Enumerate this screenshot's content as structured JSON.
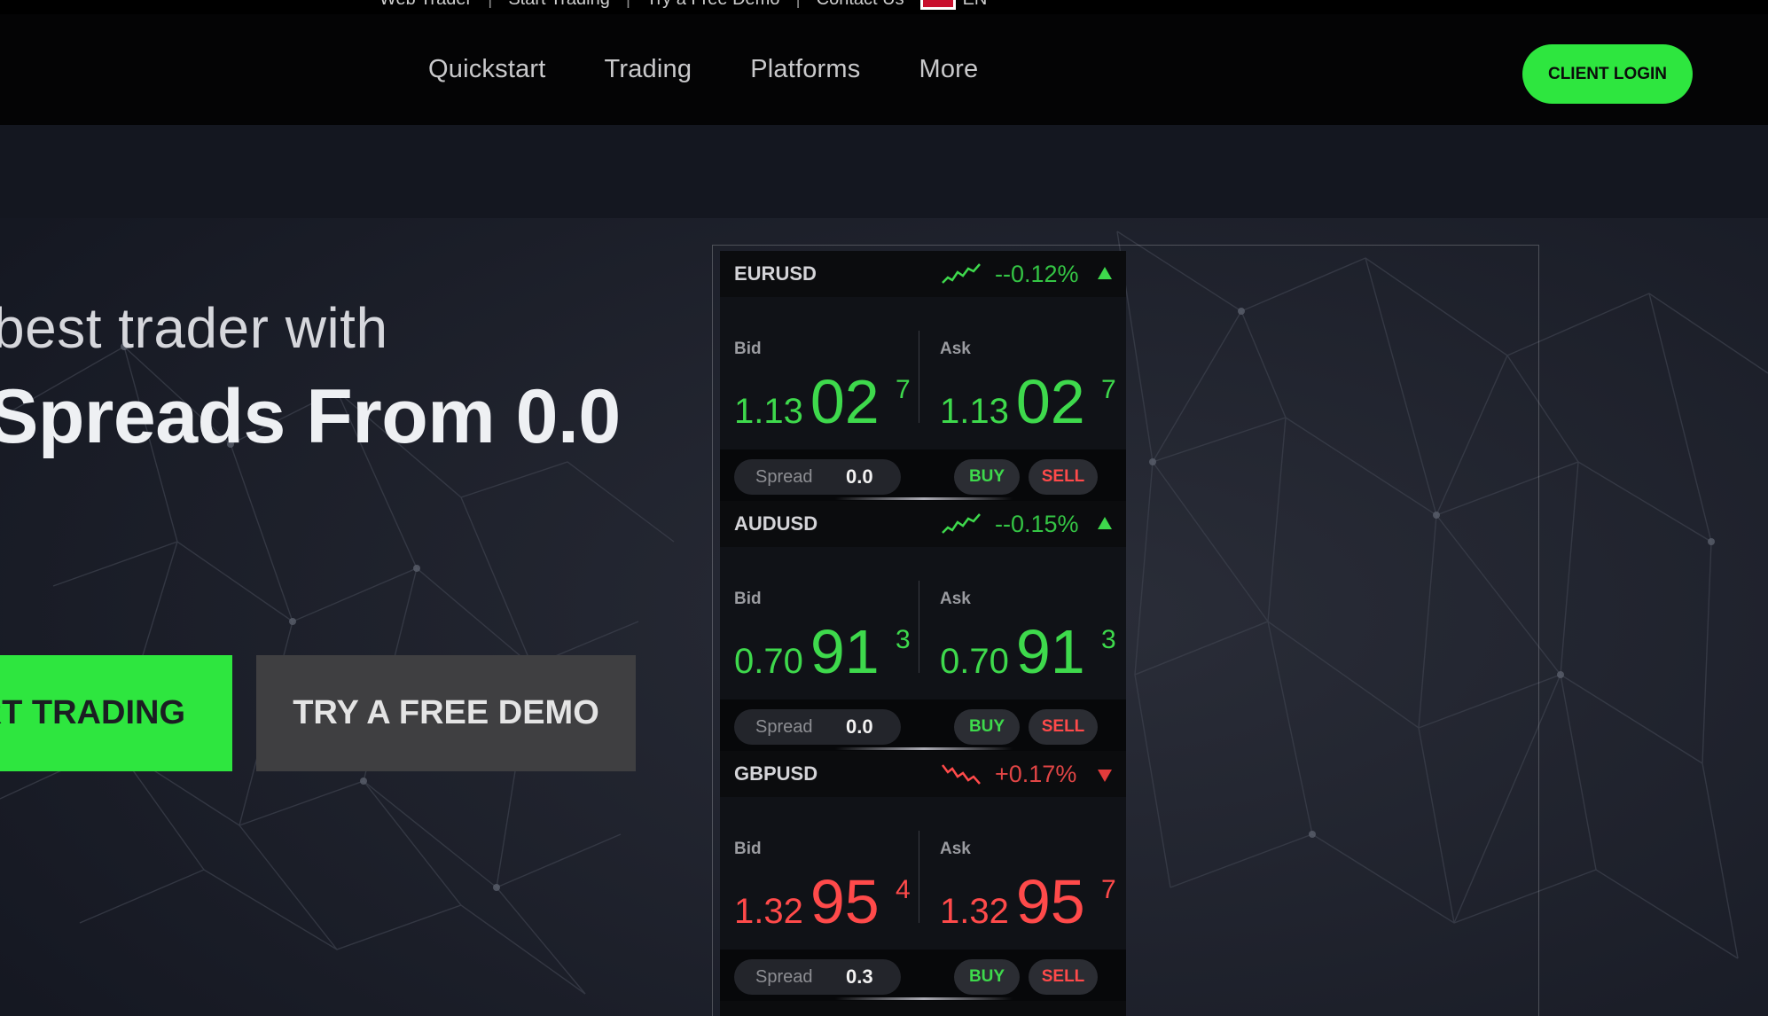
{
  "utility_bar": {
    "links": [
      "Web Trader",
      "Start Trading",
      "Try a Free Demo",
      "Contact Us"
    ],
    "language": "EN"
  },
  "nav": {
    "items": [
      "Quickstart",
      "Trading",
      "Platforms",
      "More"
    ],
    "login_label": "CLIENT LOGIN"
  },
  "hero": {
    "subheading": "best trader with",
    "heading": "Spreads From 0.0",
    "start_button": "RT TRADING",
    "demo_button": "TRY A FREE DEMO"
  },
  "colors": {
    "accent_green": "#2ee63f",
    "price_up": "#3ed94c",
    "price_down": "#ff4a4a"
  },
  "quotes": [
    {
      "symbol": "EURUSD",
      "change": "--0.12%",
      "direction": "up",
      "bid_label": "Bid",
      "bid_small": "1.13",
      "bid_big": "02",
      "bid_pip": "7",
      "ask_label": "Ask",
      "ask_small": "1.13",
      "ask_big": "02",
      "ask_pip": "7",
      "spread_label": "Spread",
      "spread": "0.0",
      "buy_label": "BUY",
      "sell_label": "SELL"
    },
    {
      "symbol": "AUDUSD",
      "change": "--0.15%",
      "direction": "up",
      "bid_label": "Bid",
      "bid_small": "0.70",
      "bid_big": "91",
      "bid_pip": "3",
      "ask_label": "Ask",
      "ask_small": "0.70",
      "ask_big": "91",
      "ask_pip": "3",
      "spread_label": "Spread",
      "spread": "0.0",
      "buy_label": "BUY",
      "sell_label": "SELL"
    },
    {
      "symbol": "GBPUSD",
      "change": "+0.17%",
      "direction": "down",
      "bid_label": "Bid",
      "bid_small": "1.32",
      "bid_big": "95",
      "bid_pip": "4",
      "ask_label": "Ask",
      "ask_small": "1.32",
      "ask_big": "95",
      "ask_pip": "7",
      "spread_label": "Spread",
      "spread": "0.3",
      "buy_label": "BUY",
      "sell_label": "SELL"
    }
  ]
}
